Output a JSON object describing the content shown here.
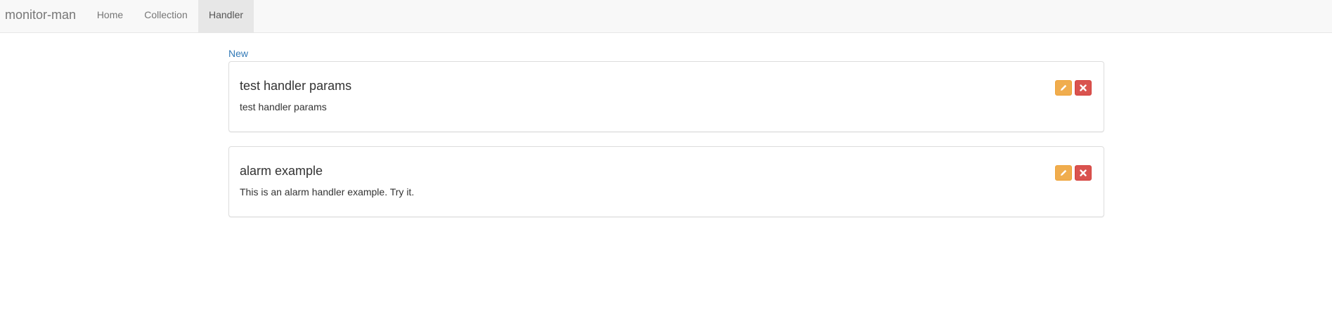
{
  "navbar": {
    "brand": "monitor-man",
    "items": [
      {
        "label": "Home",
        "active": false
      },
      {
        "label": "Collection",
        "active": false
      },
      {
        "label": "Handler",
        "active": true
      }
    ]
  },
  "main": {
    "new_label": "New",
    "handlers": [
      {
        "title": "test handler params",
        "description": "test handler params",
        "edit_icon": "pencil-icon",
        "delete_icon": "remove-icon"
      },
      {
        "title": "alarm example",
        "description": "This is an alarm handler example. Try it.",
        "edit_icon": "pencil-icon",
        "delete_icon": "remove-icon"
      }
    ]
  },
  "colors": {
    "link": "#337ab7",
    "edit_button": "#f0ad4e",
    "delete_button": "#d9534f",
    "navbar_bg": "#f8f8f8",
    "nav_active_bg": "#e7e7e7"
  }
}
